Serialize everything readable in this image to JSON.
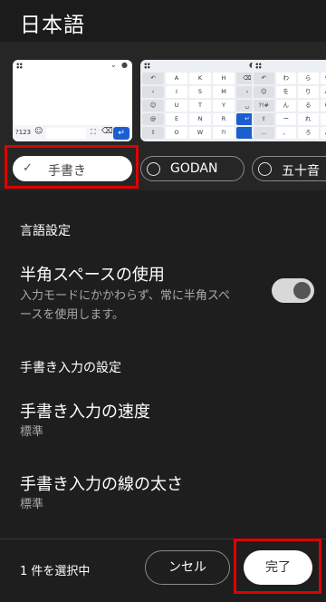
{
  "header": {
    "title": "日本語"
  },
  "keyboards": {
    "handwriting": {
      "label": "手書き",
      "preview": {
        "num_key": "?123"
      }
    },
    "godan": {
      "label": "GODAN",
      "preview": {
        "rows": [
          [
            "",
            "A",
            "K",
            "H",
            ""
          ],
          [
            "",
            "I",
            "S",
            "M",
            ""
          ],
          [
            "",
            "U",
            "T",
            "Y",
            ""
          ],
          [
            "",
            "E",
            "N",
            "R",
            ""
          ],
          [
            "",
            "O",
            "W",
            "",
            ""
          ]
        ]
      }
    },
    "kana": {
      "label": "五十音",
      "preview": {
        "rows": [
          [
            "",
            "わ",
            "ら",
            ""
          ],
          [
            "",
            "を",
            "り",
            "みひ"
          ],
          [
            "",
            "ん",
            "る",
            ""
          ],
          [
            "",
            "ー",
            "れ",
            ""
          ],
          [
            "",
            "",
            "ろ",
            ""
          ]
        ]
      }
    }
  },
  "language_settings": {
    "section_title": "言語設定",
    "half_width_space": {
      "title": "半角スペースの使用",
      "description_line1": "入力モードにかかわらず、常に半角スペ",
      "description_line2": "ースを使用します。",
      "enabled": true
    }
  },
  "handwriting_settings": {
    "section_title": "手書き入力の設定",
    "speed": {
      "title": "手書き入力の速度",
      "value": "標準"
    },
    "stroke": {
      "title": "手書き入力の線の太さ",
      "value": "標準"
    }
  },
  "footer": {
    "selection_count": "1 件を選択中",
    "cancel_label": "ンセル",
    "done_label": "完了"
  },
  "colors": {
    "background": "#1e1e1e",
    "highlight_box": "#e00000",
    "enter_key": "#1a5fd1"
  }
}
